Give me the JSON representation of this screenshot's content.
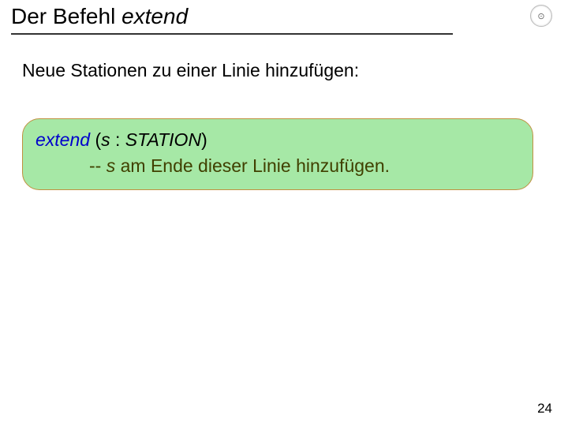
{
  "header": {
    "title_prefix": "Der Befehl ",
    "title_italic": "extend",
    "logo_glyph": "⊙"
  },
  "body": {
    "subtitle": "Neue Stationen zu einer Linie hinzufügen:"
  },
  "code": {
    "signature": {
      "keyword": "extend",
      "open": " (",
      "param": "s",
      "colon": " : ",
      "type": "STATION",
      "close": ")"
    },
    "comment": {
      "dashes": "-- ",
      "param": "s",
      "rest": " am Ende dieser Linie hinzufügen."
    }
  },
  "footer": {
    "page_number": "24"
  }
}
